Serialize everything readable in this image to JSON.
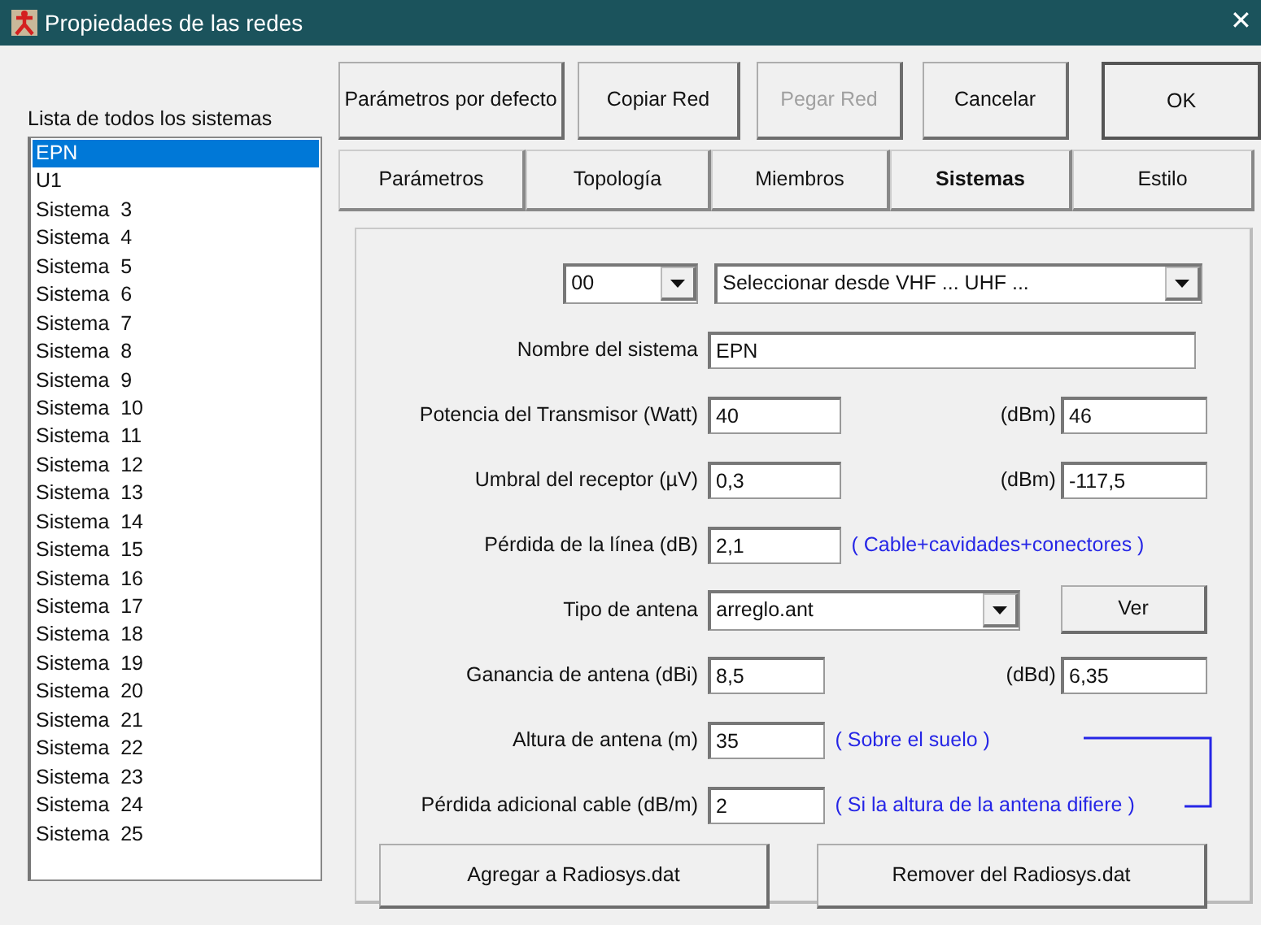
{
  "window": {
    "title": "Propiedades de las redes",
    "close": "✕"
  },
  "sidebar": {
    "title": "Lista de todos los sistemas",
    "items": [
      {
        "label": "EPN",
        "selected": true
      },
      {
        "label": "U1",
        "selected": false
      },
      {
        "label": "Sistema  3",
        "selected": false
      },
      {
        "label": "Sistema  4",
        "selected": false
      },
      {
        "label": "Sistema  5",
        "selected": false
      },
      {
        "label": "Sistema  6",
        "selected": false
      },
      {
        "label": "Sistema  7",
        "selected": false
      },
      {
        "label": "Sistema  8",
        "selected": false
      },
      {
        "label": "Sistema  9",
        "selected": false
      },
      {
        "label": "Sistema  10",
        "selected": false
      },
      {
        "label": "Sistema  11",
        "selected": false
      },
      {
        "label": "Sistema  12",
        "selected": false
      },
      {
        "label": "Sistema  13",
        "selected": false
      },
      {
        "label": "Sistema  14",
        "selected": false
      },
      {
        "label": "Sistema  15",
        "selected": false
      },
      {
        "label": "Sistema  16",
        "selected": false
      },
      {
        "label": "Sistema  17",
        "selected": false
      },
      {
        "label": "Sistema  18",
        "selected": false
      },
      {
        "label": "Sistema  19",
        "selected": false
      },
      {
        "label": "Sistema  20",
        "selected": false
      },
      {
        "label": "Sistema  21",
        "selected": false
      },
      {
        "label": "Sistema  22",
        "selected": false
      },
      {
        "label": "Sistema  23",
        "selected": false
      },
      {
        "label": "Sistema  24",
        "selected": false
      },
      {
        "label": "Sistema  25",
        "selected": false
      }
    ]
  },
  "toolbar": [
    {
      "label": "Parámetros por defecto",
      "disabled": false,
      "default": false
    },
    {
      "label": "Copiar Red",
      "disabled": false,
      "default": false
    },
    {
      "label": "Pegar Red",
      "disabled": true,
      "default": false
    },
    {
      "label": "Cancelar",
      "disabled": false,
      "default": false
    },
    {
      "label": "OK",
      "disabled": false,
      "default": true
    }
  ],
  "tabs": [
    {
      "label": "Parámetros",
      "selected": false
    },
    {
      "label": "Topología",
      "selected": false
    },
    {
      "label": "Miembros",
      "selected": false
    },
    {
      "label": "Sistemas",
      "selected": true
    },
    {
      "label": "Estilo",
      "selected": false
    }
  ],
  "form": {
    "rows": [
      {
        "kind": "selects",
        "code": "00",
        "band": "Seleccionar desde VHF ... UHF ..."
      },
      {
        "kind": "wide",
        "label": "Nombre del sistema",
        "value": "EPN"
      },
      {
        "kind": "pair",
        "label": "Potencia del Transmisor (Watt)",
        "value": "40",
        "unit": "(dBm)",
        "unit_value": "46"
      },
      {
        "kind": "pair",
        "label": "Umbral del receptor (µV)",
        "value": "0,3",
        "unit": "(dBm)",
        "unit_value": "-117,5"
      },
      {
        "kind": "note",
        "label": "Pérdida de la línea (dB)",
        "value": "2,1",
        "note": "( Cable+cavidades+conectores )"
      },
      {
        "kind": "select",
        "label": "Tipo de antena",
        "value": "arreglo.ant",
        "button": "Ver"
      },
      {
        "kind": "pair",
        "label": "Ganancia de antena (dBi)",
        "value": "8,5",
        "unit": "(dBd)",
        "unit_value": "6,35"
      },
      {
        "kind": "note",
        "label": "Altura de antena (m)",
        "value": "35",
        "note": "( Sobre el suelo )"
      },
      {
        "kind": "note",
        "label": "Pérdida adicional cable (dB/m)",
        "value": "2",
        "note": "( Si la altura de la antena difiere )"
      }
    ],
    "buttons": [
      "Agregar a Radiosys.dat",
      "Remover del Radiosys.dat"
    ]
  }
}
